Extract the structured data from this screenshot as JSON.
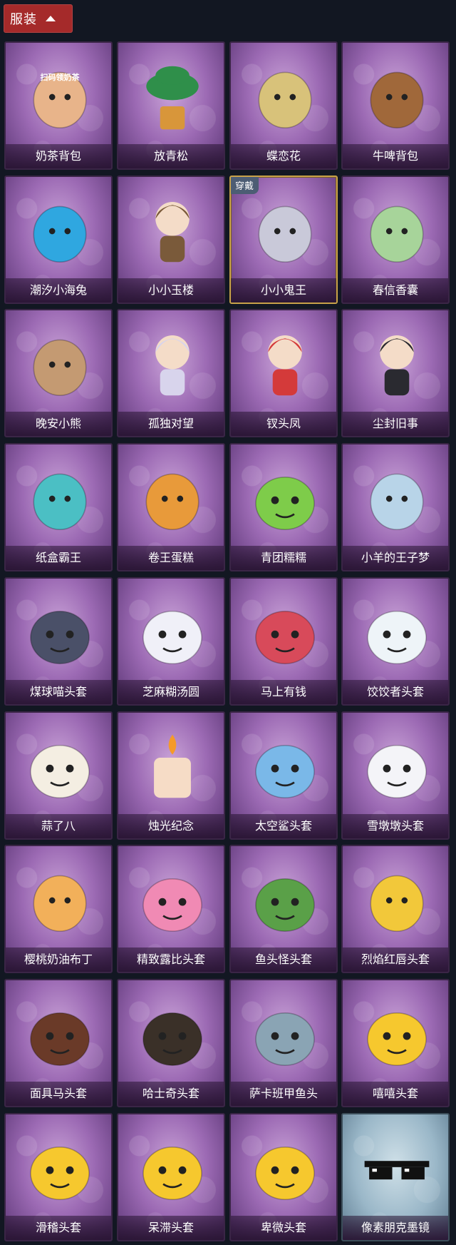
{
  "header": {
    "label": "服装",
    "caret_icon": "caret-up-icon",
    "color": "#a52a2a"
  },
  "equipped_badge": "穿戴",
  "items": [
    {
      "name": "奶茶背包",
      "icon": "milk-tea-bag-icon",
      "color": "#e8b48a",
      "printed_text": "扫码领奶茶"
    },
    {
      "name": "放青松",
      "icon": "bonsai-pine-icon",
      "color": "#2f8f4a"
    },
    {
      "name": "蝶恋花",
      "icon": "butterfly-bell-icon",
      "color": "#d8c27a"
    },
    {
      "name": "牛啤背包",
      "icon": "cow-beer-barrel-icon",
      "color": "#a0683a"
    },
    {
      "name": "潮汐小海兔",
      "icon": "blue-sea-bunny-icon",
      "color": "#2fa7e0"
    },
    {
      "name": "小小玉楼",
      "icon": "chibi-figure-icon",
      "color": "#7a5a3a"
    },
    {
      "name": "小小鬼王",
      "icon": "chibi-ghost-king-icon",
      "color": "#c9c9d9",
      "equipped": true
    },
    {
      "name": "春信香囊",
      "icon": "sachet-icon",
      "color": "#a7d49a"
    },
    {
      "name": "晚安小熊",
      "icon": "bear-icon",
      "color": "#c49a72"
    },
    {
      "name": "孤独对望",
      "icon": "white-hair-figure-icon",
      "color": "#d8d4ec"
    },
    {
      "name": "钗头凤",
      "icon": "phoenix-crown-figure-icon",
      "color": "#d43a3a"
    },
    {
      "name": "尘封旧事",
      "icon": "dark-hair-figure-icon",
      "color": "#2a2a30"
    },
    {
      "name": "纸盒霸王",
      "icon": "box-dinosaur-icon",
      "color": "#4bbfc4"
    },
    {
      "name": "卷王蛋糕",
      "icon": "roll-cake-icon",
      "color": "#e89a3a"
    },
    {
      "name": "青团糯糯",
      "icon": "green-rice-ball-icon",
      "color": "#7ecc4a"
    },
    {
      "name": "小羊的王子梦",
      "icon": "sheep-prince-icon",
      "color": "#b8d4e8"
    },
    {
      "name": "煤球喵头套",
      "icon": "cat-head-icon",
      "color": "#4a5068"
    },
    {
      "name": "芝麻糊汤圆",
      "icon": "rice-dumpling-icon",
      "color": "#f0f0f8"
    },
    {
      "name": "马上有钱",
      "icon": "red-horse-icon",
      "color": "#d84a5a"
    },
    {
      "name": "饺饺者头套",
      "icon": "dumpling-cloud-icon",
      "color": "#eef4f8"
    },
    {
      "name": "蒜了八",
      "icon": "garlic-icon",
      "color": "#f4eee2"
    },
    {
      "name": "烛光纪念",
      "icon": "candle-icon",
      "color": "#f6dcc6"
    },
    {
      "name": "太空鲨头套",
      "icon": "shark-head-icon",
      "color": "#7ab8e8"
    },
    {
      "name": "雪墩墩头套",
      "icon": "snowman-head-icon",
      "color": "#f4f4f8"
    },
    {
      "name": "樱桃奶油布丁",
      "icon": "pudding-icon",
      "color": "#f2b05a"
    },
    {
      "name": "精致露比头套",
      "icon": "pink-beaver-icon",
      "color": "#f08ab4"
    },
    {
      "name": "鱼头怪头套",
      "icon": "fish-head-icon",
      "color": "#5aa048"
    },
    {
      "name": "烈焰红唇头套",
      "icon": "pika-sunglasses-icon",
      "color": "#f2c83a"
    },
    {
      "name": "面具马头套",
      "icon": "horse-mask-icon",
      "color": "#6a3a28"
    },
    {
      "name": "哈士奇头套",
      "icon": "husky-head-icon",
      "color": "#3a3028"
    },
    {
      "name": "萨卡班甲鱼头",
      "icon": "sacabambaspis-icon",
      "color": "#8aa4b4"
    },
    {
      "name": "嘻嘻头套",
      "icon": "grin-emoji-icon",
      "color": "#f6c82e"
    },
    {
      "name": "滑稽头套",
      "icon": "smirk-emoji-icon",
      "color": "#f6c82e"
    },
    {
      "name": "呆滞头套",
      "icon": "dazed-emoji-icon",
      "color": "#f6c82e"
    },
    {
      "name": "卑微头套",
      "icon": "humble-emoji-icon",
      "color": "#f6c82e"
    },
    {
      "name": "像素朋克墨镜",
      "icon": "pixel-sunglasses-icon",
      "color": "#111111",
      "card_style": "blue"
    }
  ]
}
